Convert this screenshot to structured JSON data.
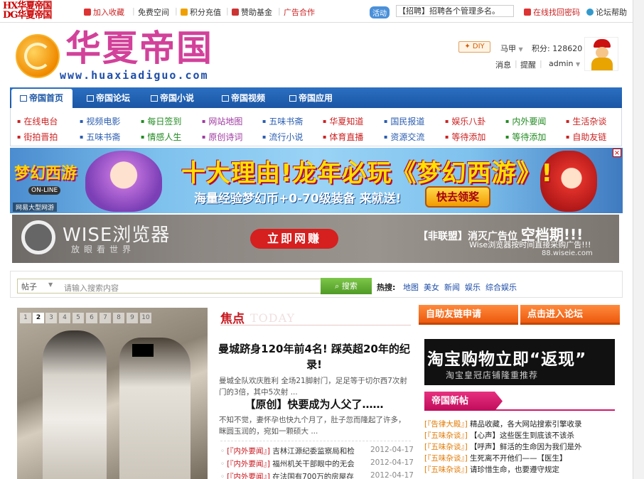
{
  "topbar": {
    "logo_line1": "HX华夏帝国",
    "logo_line2": "DG华夏帝国",
    "links": [
      {
        "label": "加入收藏",
        "icon": "bookmark-icon"
      },
      {
        "label": "免费空间",
        "icon": ""
      },
      {
        "label": "积分充值",
        "icon": "coin-icon"
      },
      {
        "label": "赞助基金",
        "icon": "gift-icon"
      },
      {
        "label": "广告合作",
        "icon": ""
      }
    ],
    "notice_tag": "活动",
    "notice_text": "【招聘】招聘各个管理多名。",
    "right_links": [
      {
        "label": "在线找回密码",
        "icon": "key-icon"
      },
      {
        "label": "论坛帮助",
        "icon": "help-icon"
      }
    ]
  },
  "header": {
    "logo_text": "华夏帝国",
    "logo_url": "www.huaxiadiguo.com",
    "diy": "DIY",
    "username": "马甲",
    "points": "积分: 128620",
    "links": [
      "消息",
      "提醒",
      "admin"
    ]
  },
  "nav": {
    "tabs": [
      "帝国首页",
      "帝国论坛",
      "帝国小说",
      "帝国视频",
      "帝国应用"
    ]
  },
  "subnav": {
    "row1": [
      "在线电台",
      "视频电影",
      "每日签到",
      "网站地图",
      "五味书斋",
      "华夏知道",
      "国民报道",
      "娱乐八卦",
      "内外要闻",
      "生活杂谈"
    ],
    "row2": [
      "街拍晋拍",
      "五味书斋",
      "情感人生",
      "原创诗词",
      "流行小说",
      "体育直播",
      "资源交流",
      "等待添加",
      "等待添加",
      "自助友链"
    ]
  },
  "banner1": {
    "game_logo": "梦幻西游",
    "game_logo_sub": "ON-LINE",
    "headline": "十大理由!龙年必玩《梦幻西游》!",
    "sub": "海量经验梦幻币+0-70级装备 来就送!",
    "button": "快去领奖",
    "footer": "网易大型网游",
    "close": "×"
  },
  "banner2": {
    "logo": "WISE浏览器",
    "slogan": "放眼看世界",
    "button": "立即网赚",
    "right_title_prefix": "【非联盟】消灭广告位",
    "right_title_big": "空档期!!!",
    "right_sub": "Wise浏览器按时间直接采购广告!!!",
    "right_url": "88.wiseie.com"
  },
  "search": {
    "type": "帖子",
    "placeholder": "请输入搜索内容",
    "button": "搜索",
    "hot_label": "热搜:",
    "hot": [
      "地图",
      "美女",
      "新闻",
      "娱乐",
      "综合娱乐"
    ]
  },
  "slide": {
    "pages": [
      "1",
      "2",
      "3",
      "4",
      "5",
      "6",
      "7",
      "8",
      "9",
      "10"
    ],
    "active": "2"
  },
  "focus": {
    "title": "焦点",
    "title_en": "TODAY",
    "headline1": "曼城跻身120年前4名! 踩英超20年的纪录!",
    "desc1": "曼城全队欢庆胜利 全场21脚射门，足足等于切尔西7次射门的3倍，其中5次射 ...",
    "headline2": "【原创】快要成为人父了……",
    "desc2": "不知不觉，妻怀孕也快九个月了，肚子忽而隆起了许多，眯圆玉润的，宛如一颗硕大 ...",
    "news": [
      {
        "cat": "[『内外要闻』]",
        "title": "吉林江源纪委监察局和检",
        "date": "2012-04-17"
      },
      {
        "cat": "[『内外要闻』]",
        "title": "福州机关干部眼中的无会",
        "date": "2012-04-17"
      },
      {
        "cat": "[『内外要闻』]",
        "title": "在法国有700万的房屋存",
        "date": "2012-04-17"
      }
    ]
  },
  "right": {
    "btn1": "自助友链申请",
    "btn2": "点击进入论坛",
    "taobao_title": "淘宝购物立即“返现”",
    "taobao_sub": "淘宝皇冠店铺隆重推荐",
    "newpost_title": "帝国新帖",
    "posts": [
      {
        "cat": "[『告律大殿』]",
        "title": "精品收藏，各大网站搜索引擎收录"
      },
      {
        "cat": "[『五味杂谈』]",
        "title": "【心声】这些医生到底该不该杀"
      },
      {
        "cat": "[『五味杂谈』]",
        "title": "【呼声】鲜活的生命因为我们是外"
      },
      {
        "cat": "[『五味杂谈』]",
        "title": "生死离不开他们——【医生】"
      },
      {
        "cat": "[『五味杂谈』]",
        "title": "请珍惜生命，也要遵守规定"
      }
    ]
  },
  "colors": {
    "nav_blue": "#1b56a4",
    "brand_pink": "#d2419a",
    "accent_red": "#c8161d",
    "orange": "#ec5a0d"
  }
}
